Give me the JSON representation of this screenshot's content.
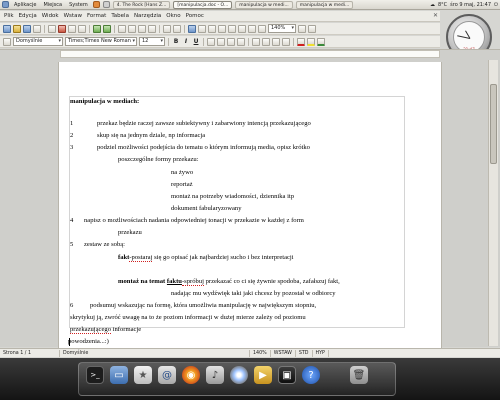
{
  "top_panel": {
    "menus": [
      "Aplikacje",
      "Miejsca",
      "System"
    ],
    "tasks": [
      {
        "label": "4. The Rock [Hans Z...",
        "active": false
      },
      {
        "label": "[manipulacja.doc - O...",
        "active": true
      },
      {
        "label": "manipulacja w medi...",
        "active": false
      },
      {
        "label": "manipulacja w medi...",
        "active": false
      }
    ],
    "tray": {
      "temp": "8°C",
      "datetime": "śro 9 maj, 21:47"
    }
  },
  "menubar": {
    "items": [
      "Plik",
      "Edycja",
      "Widok",
      "Wstaw",
      "Format",
      "Tabela",
      "Narzędzia",
      "Okno",
      "Pomoc"
    ]
  },
  "toolbar": {
    "zoom": "140%",
    "style": "Domyślnie",
    "font": "Times;Times New Roman",
    "size": "12"
  },
  "clock": {
    "text": "21:47"
  },
  "document": {
    "heading": "manipulacja w mediach:",
    "items": [
      {
        "num": "1",
        "text": "przekaz będzie raczej zawsze subiektywny i zabarwiony intencją przekazującego"
      },
      {
        "num": "2",
        "text": "skup się na jednym dziale, np informacja"
      },
      {
        "num": "3",
        "text": "podziel możliwości podejścia do tematu o którym informują media, opisz krótko"
      }
    ],
    "item3_cont": "poszczególne formy przekazu:",
    "forms": [
      "na żywo",
      "reportaż",
      "montaż na potrzeby wiadomości, dziennika itp",
      "dokument fabularyzowany"
    ],
    "item4": {
      "num": "4",
      "text": "napisz o możliwościach nadania odpowiedniej tonacji w przekazie w każdej z form"
    },
    "item4_cont": "przekazu",
    "item5": {
      "num": "5",
      "text": "zestaw ze sobą:"
    },
    "fakt": {
      "bold": "fakt",
      "spell": "-postaraj",
      "rest": " się go opisać jak najbardziej sucho i bez interpretacji"
    },
    "montaz": {
      "bold": "montaż na temat ",
      "bold_u": "faktu",
      "spell": "-spróbuj",
      "rest": " przekazać co ci się żywnie spodoba, zafałszuj fakt,"
    },
    "montaz_cont": "nadając mu wydźwięk taki jaki chcesz by pozostał w odbiorcy",
    "item6": {
      "num": "6",
      "text": "podsumuj wskazując na formę, która umożliwia manipulację w największym stopniu,"
    },
    "item6_cont1": "skrytykuj ją, zwróć uwagę na to że poziom informacji w dużej mierze zależy od poziomu",
    "item6_cont2_spell": "przekazującego",
    "item6_cont2_rest": " informacje",
    "closing": "powodzenia...:)"
  },
  "statusbar": {
    "page": "Strona 1 / 1",
    "style": "Domyślnie",
    "zoom": "140%",
    "mode1": "WSTAW",
    "mode2": "STD",
    "mode3": "HYP"
  },
  "dock": {
    "icons": [
      "terminal-icon",
      "folder-icon",
      "star-icon",
      "email-icon",
      "firefox-icon",
      "music-icon",
      "disc-icon",
      "media-icon",
      "video-icon",
      "help-icon",
      "trash-icon"
    ]
  }
}
